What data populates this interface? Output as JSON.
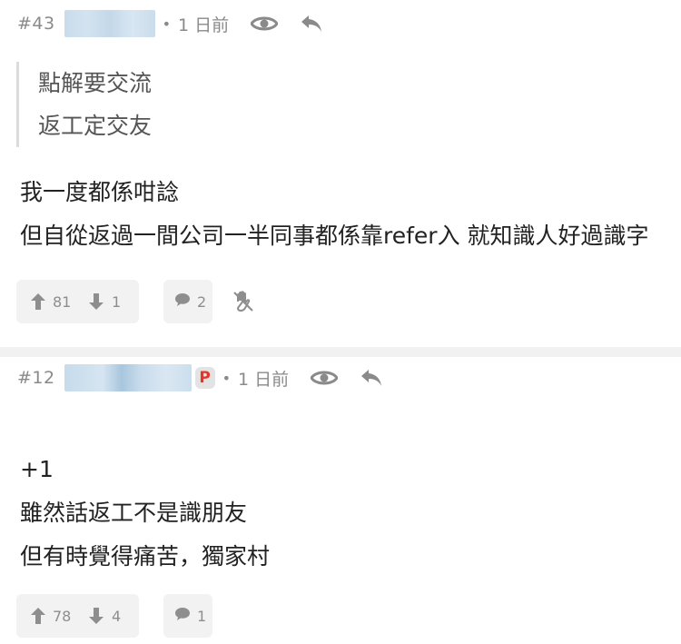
{
  "colors": {
    "meta_gray": "#8a8a8a",
    "badge_red": "#e5342a",
    "action_bg": "#f2f2f2",
    "separator": "#f1f1f1",
    "quote_border": "#dcdcdc"
  },
  "posts": [
    {
      "number": "#43",
      "time": "1 日前",
      "quote_lines": [
        "點解要交流",
        "返工定交友"
      ],
      "content_lines": [
        "我一度都係咁諗",
        "但自從返過一間公司一半同事都係靠refer入 就知識人好過識字"
      ],
      "upvotes": "81",
      "downvotes": "1",
      "comments": "2",
      "icons": [
        "eye-icon",
        "reply-icon",
        "thumb-up-icon",
        "thumb-down-icon",
        "comment-icon",
        "hand-stop-icon"
      ]
    },
    {
      "number": "#12",
      "badge": "P",
      "time": "1 日前",
      "content_lines": [
        "+1",
        "雖然話返工不是識朋友",
        "但有時覺得痛苦，獨家村"
      ],
      "upvotes": "78",
      "downvotes": "4",
      "comments": "1",
      "icons": [
        "eye-icon",
        "reply-icon",
        "thumb-up-icon",
        "thumb-down-icon",
        "comment-icon"
      ]
    }
  ]
}
